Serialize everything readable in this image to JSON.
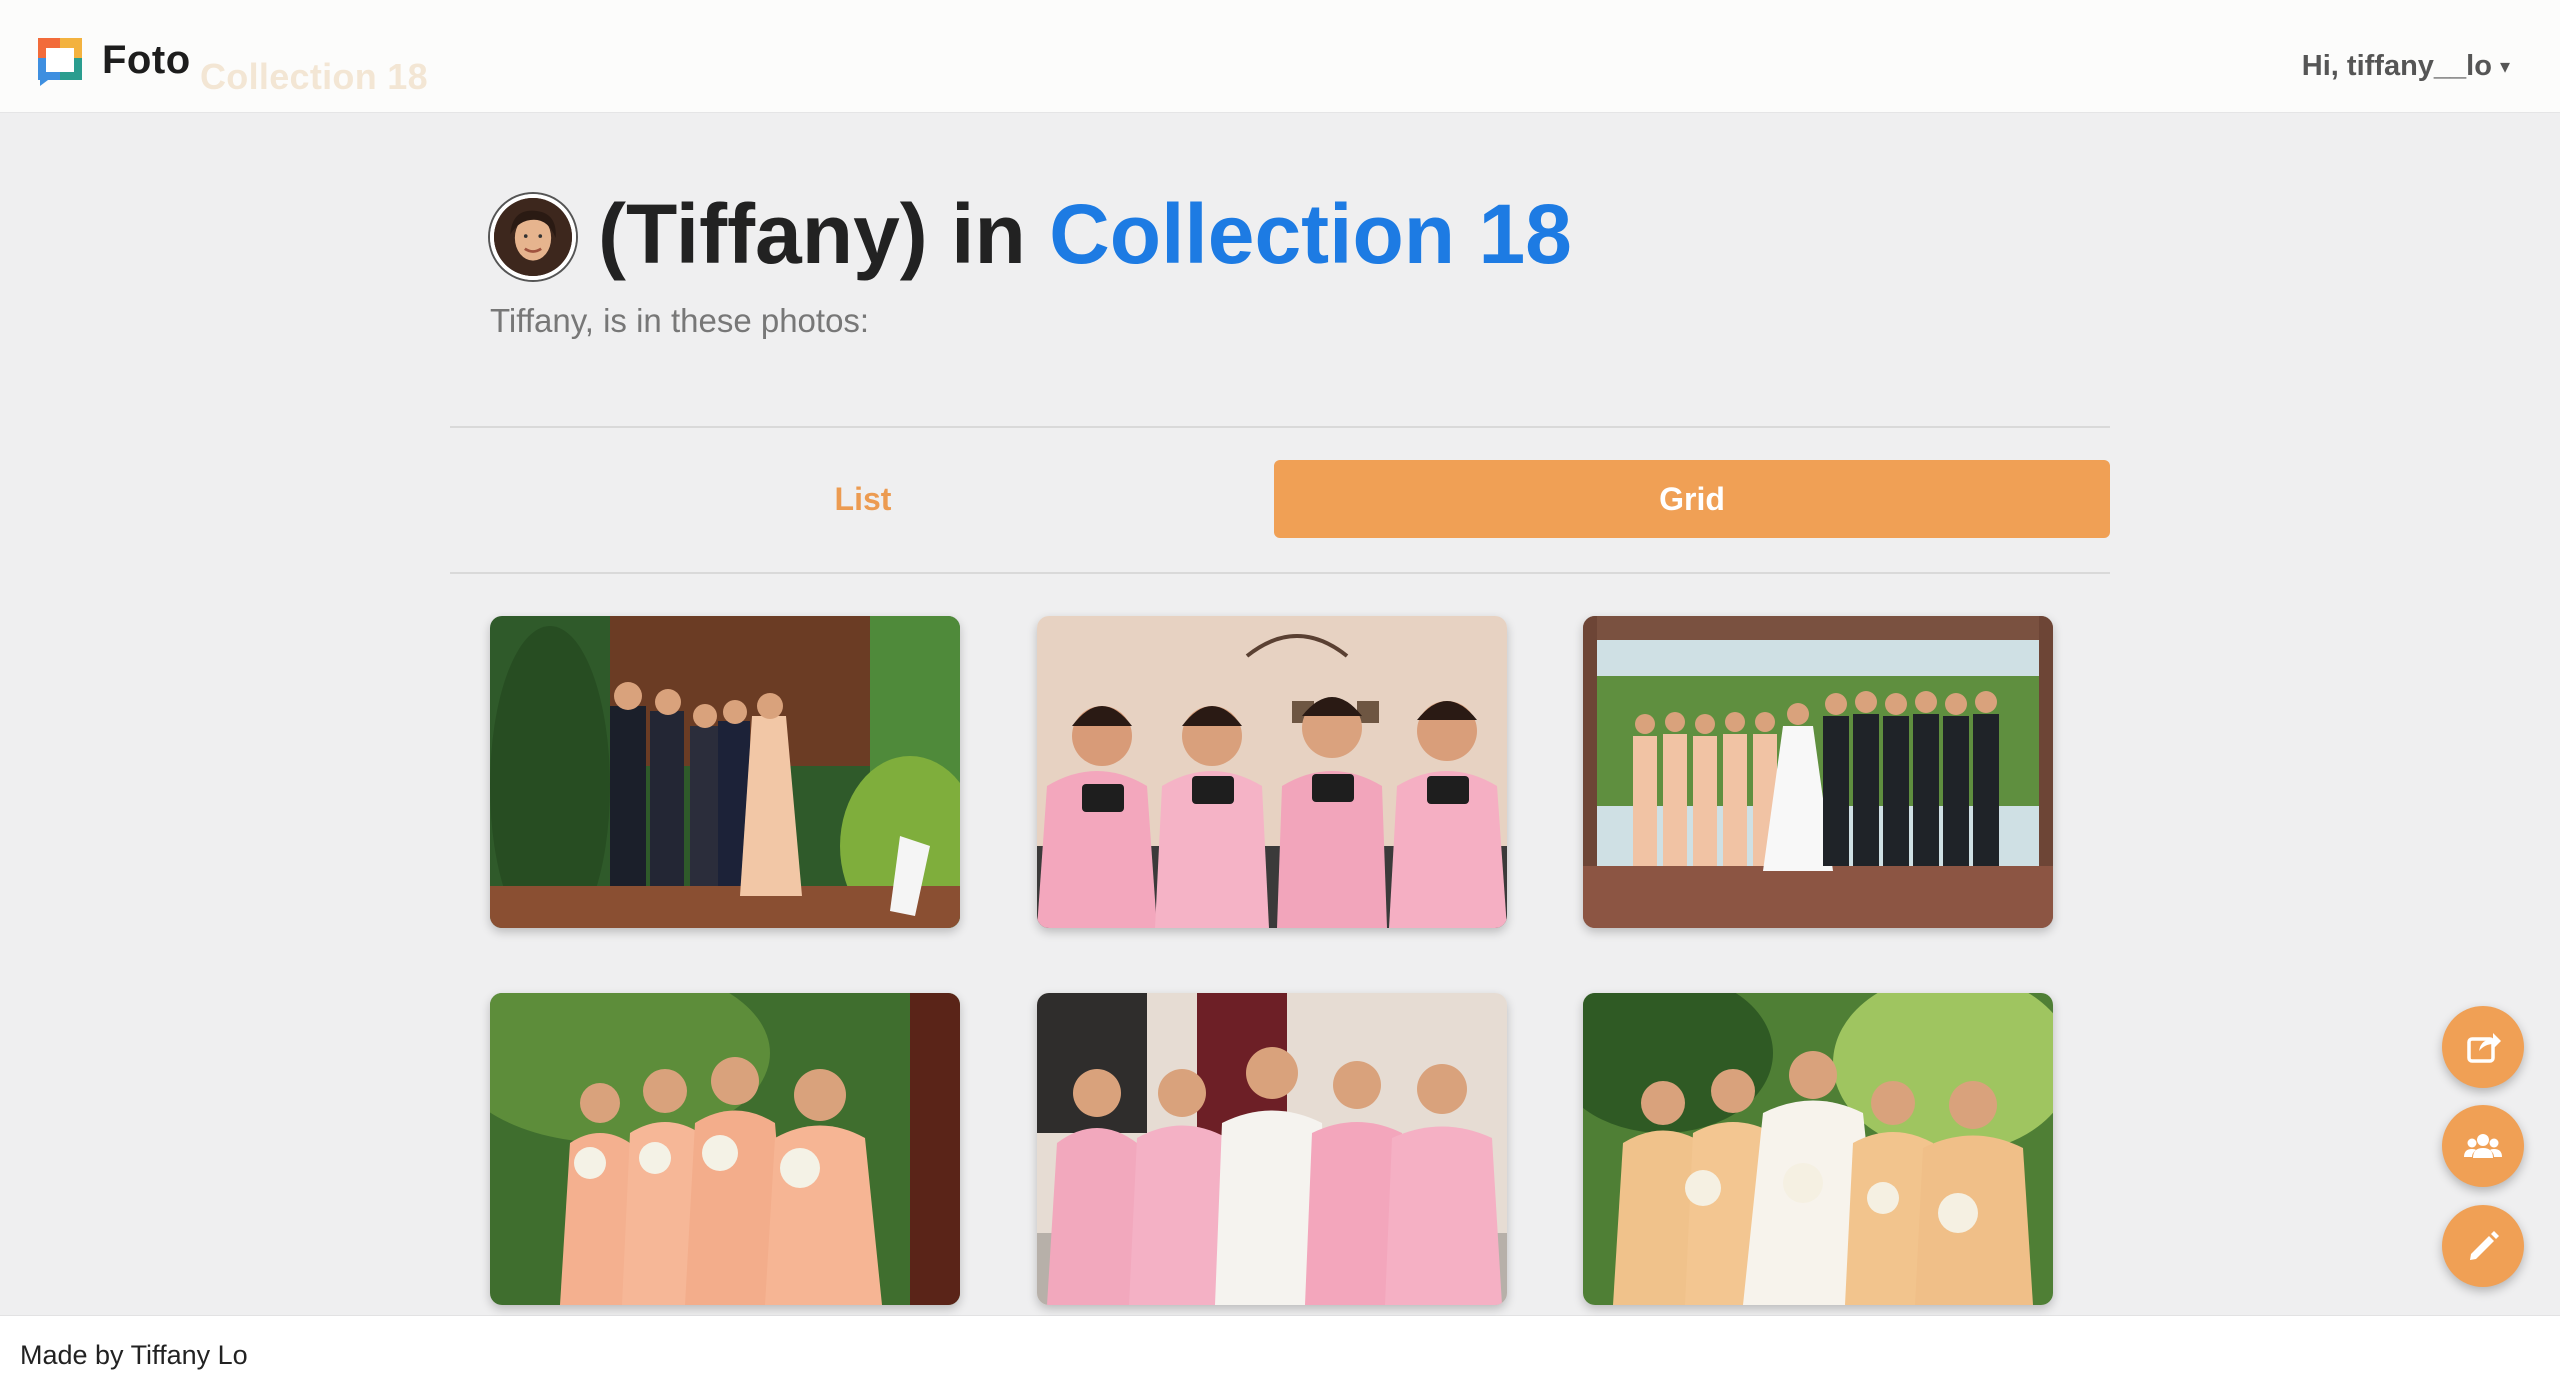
{
  "app": {
    "brand": "Foto",
    "ghost_title": "Collection 18"
  },
  "user_menu": {
    "greeting": "Hi, tiffany__lo",
    "caret": "▾"
  },
  "header": {
    "title_prefix": "(Tiffany) in ",
    "title_collection": "Collection 18",
    "subtitle": "Tiffany, is in these photos:"
  },
  "view_toggle": {
    "list_label": "List",
    "grid_label": "Grid",
    "selected": "Grid"
  },
  "photos": [
    {
      "scene": "garden-formal-group"
    },
    {
      "scene": "bridesmaids-pink-robes"
    },
    {
      "scene": "wedding-party-deck"
    },
    {
      "scene": "bridesmaids-peach-dresses"
    },
    {
      "scene": "bride-toast-robes"
    },
    {
      "scene": "bride-with-bridesmaids-garden"
    }
  ],
  "fabs": [
    {
      "icon": "share-icon"
    },
    {
      "icon": "people-icon"
    },
    {
      "icon": "pencil-icon"
    }
  ],
  "footer": {
    "text": "Made by Tiffany Lo"
  },
  "colors": {
    "accent_orange": "#f0a055",
    "accent_blue": "#1d7be3",
    "background": "#efeff0"
  }
}
